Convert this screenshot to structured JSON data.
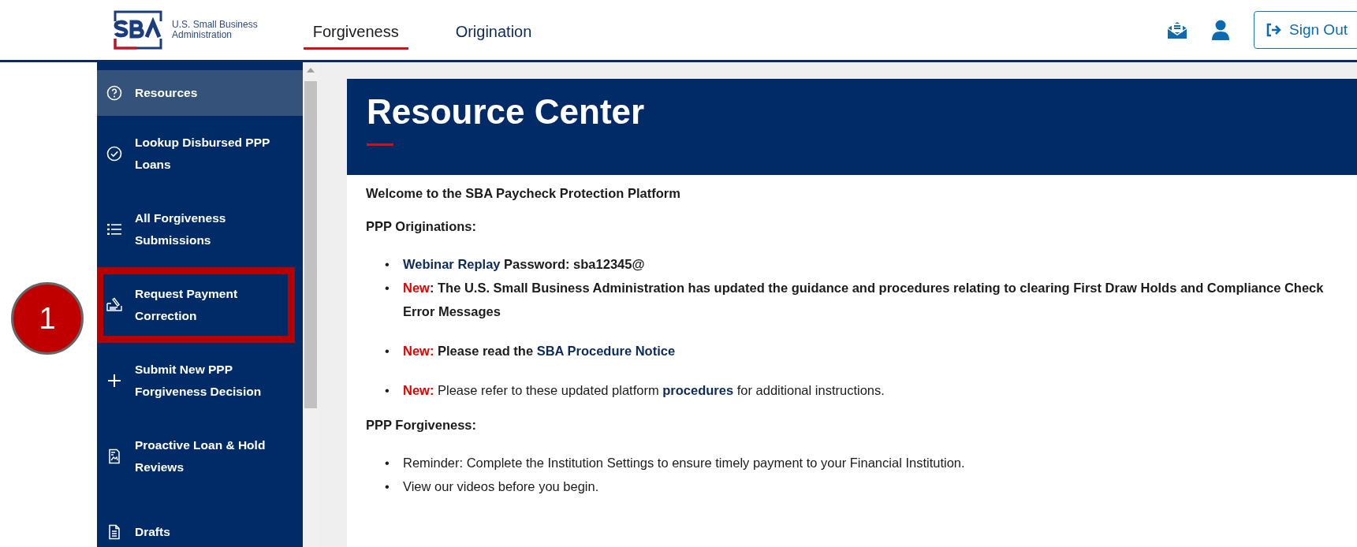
{
  "header": {
    "logo_text": "U.S. Small Business\nAdministration",
    "tabs": [
      {
        "label": "Forgiveness",
        "selected": true
      },
      {
        "label": "Origination",
        "selected": false
      }
    ],
    "sign_out": "Sign Out"
  },
  "sidebar": {
    "items": [
      {
        "label": "Resources",
        "selected": true,
        "annotated": false
      },
      {
        "label": "Lookup Disbursed PPP Loans",
        "selected": false,
        "annotated": false
      },
      {
        "label": "All Forgiveness Submissions",
        "selected": false,
        "annotated": false
      },
      {
        "label": "Request Payment Correction",
        "selected": false,
        "annotated": true
      },
      {
        "label": "Submit New PPP Forgiveness Decision",
        "selected": false,
        "annotated": false
      },
      {
        "label": "Proactive Loan & Hold Reviews",
        "selected": false,
        "annotated": false
      },
      {
        "label": "Drafts",
        "selected": false,
        "annotated": false
      }
    ]
  },
  "annotation": {
    "number": "1"
  },
  "content": {
    "title": "Resource Center",
    "sections": [
      {
        "kind": "text",
        "text": "Welcome to the SBA Paycheck Protection Platform"
      },
      {
        "kind": "heading",
        "text": "PPP Originations:"
      },
      {
        "kind": "list",
        "strong": true,
        "items": [
          [
            {
              "kind": "marker",
              "text": "•"
            },
            {
              "kind": "link",
              "text": "Webinar Replay"
            },
            {
              "kind": "plain",
              "text": " Password: sba12345@"
            }
          ],
          [
            {
              "kind": "marker",
              "text": "•"
            },
            {
              "kind": "new",
              "text": "New"
            },
            {
              "kind": "plain",
              "text": ": The U.S. Small Business Administration has updated the guidance and procedures relating to clearing First Draw Holds and Compliance Check Error Messages"
            }
          ]
        ]
      },
      {
        "kind": "list",
        "strong": true,
        "items": [
          [
            {
              "kind": "marker",
              "text": "•"
            },
            {
              "kind": "new",
              "text": "New:"
            },
            {
              "kind": "plain",
              "text": " Please read the "
            },
            {
              "kind": "link",
              "text": "SBA Procedure Notice"
            }
          ]
        ]
      },
      {
        "kind": "list",
        "strong": false,
        "items": [
          [
            {
              "kind": "marker",
              "text": "•"
            },
            {
              "kind": "new",
              "text": "New:"
            },
            {
              "kind": "plain",
              "text": " Please refer to these updated platform "
            },
            {
              "kind": "boldlink",
              "text": "procedures"
            },
            {
              "kind": "plain",
              "text": " for additional instructions."
            }
          ]
        ]
      },
      {
        "kind": "heading",
        "text": "PPP Forgiveness:"
      },
      {
        "kind": "list",
        "strong": false,
        "items": [
          [
            {
              "kind": "marker",
              "text": "•"
            },
            {
              "kind": "plain",
              "text": "Reminder: Complete the Institution Settings to ensure timely payment to your Financial Institution."
            }
          ],
          [
            {
              "kind": "marker",
              "text": "•"
            },
            {
              "kind": "plain",
              "text": "View our videos before you begin."
            }
          ]
        ]
      }
    ]
  }
}
